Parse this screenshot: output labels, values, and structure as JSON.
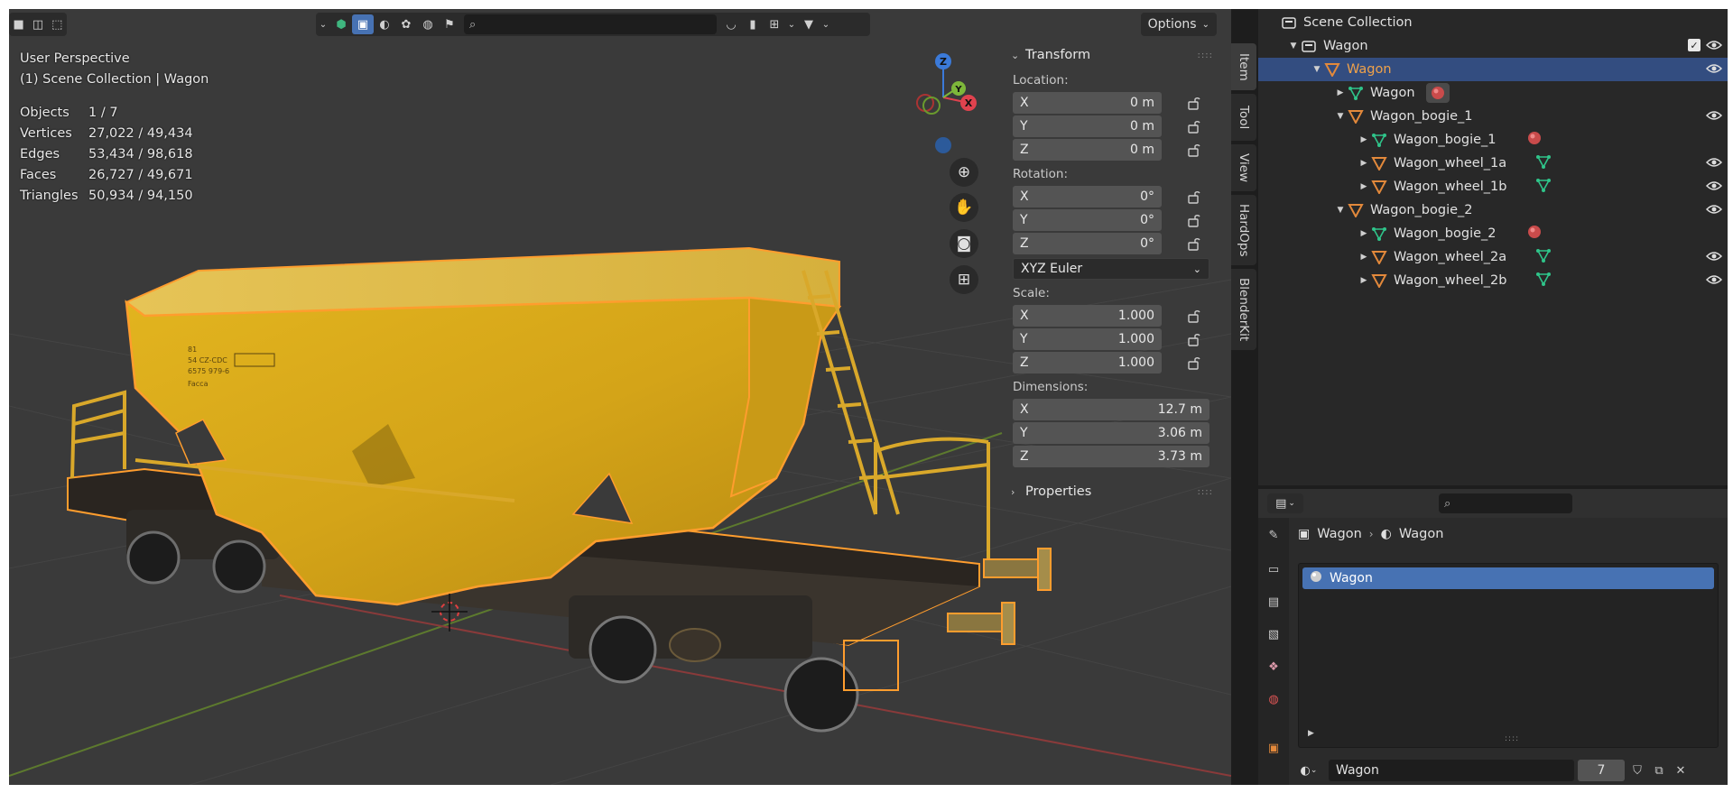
{
  "viewport": {
    "header": {
      "options_label": "Options",
      "search_placeholder": ""
    },
    "info": {
      "perspective": "User Perspective",
      "collection": "(1) Scene Collection | Wagon"
    },
    "stats": [
      {
        "label": "Objects",
        "value": "1 / 7"
      },
      {
        "label": "Vertices",
        "value": "27,022 / 49,434"
      },
      {
        "label": "Edges",
        "value": "53,434 / 98,618"
      },
      {
        "label": "Faces",
        "value": "26,727 / 49,671"
      },
      {
        "label": "Triangles",
        "value": "50,934 / 94,150"
      }
    ],
    "gizmo": {
      "z": "Z",
      "y": "Y",
      "x": "X"
    },
    "wagon_markings": [
      "81",
      "54 CZ-CDC",
      "6575 979-6",
      "Facca"
    ]
  },
  "npanel": {
    "transform": {
      "header": "Transform",
      "location_label": "Location:",
      "location": [
        {
          "axis": "X",
          "value": "0 m"
        },
        {
          "axis": "Y",
          "value": "0 m"
        },
        {
          "axis": "Z",
          "value": "0 m"
        }
      ],
      "rotation_label": "Rotation:",
      "rotation": [
        {
          "axis": "X",
          "value": "0°"
        },
        {
          "axis": "Y",
          "value": "0°"
        },
        {
          "axis": "Z",
          "value": "0°"
        }
      ],
      "rotation_mode": "XYZ Euler",
      "scale_label": "Scale:",
      "scale": [
        {
          "axis": "X",
          "value": "1.000"
        },
        {
          "axis": "Y",
          "value": "1.000"
        },
        {
          "axis": "Z",
          "value": "1.000"
        }
      ],
      "dimensions_label": "Dimensions:",
      "dimensions": [
        {
          "axis": "X",
          "value": "12.7 m"
        },
        {
          "axis": "Y",
          "value": "3.06 m"
        },
        {
          "axis": "Z",
          "value": "3.73 m"
        }
      ]
    },
    "properties_header": "Properties",
    "side_tabs": [
      "Item",
      "Tool",
      "View",
      "HardOps",
      "BlenderKit"
    ]
  },
  "outliner": {
    "rows": [
      {
        "label": "Scene Collection",
        "type": "scene"
      },
      {
        "label": "Wagon",
        "type": "collection"
      },
      {
        "label": "Wagon",
        "type": "object"
      },
      {
        "label": "Wagon",
        "type": "mesh"
      },
      {
        "label": "Wagon_bogie_1",
        "type": "object"
      },
      {
        "label": "Wagon_bogie_1",
        "type": "mesh"
      },
      {
        "label": "Wagon_wheel_1a",
        "type": "object"
      },
      {
        "label": "Wagon_wheel_1b",
        "type": "object"
      },
      {
        "label": "Wagon_bogie_2",
        "type": "object"
      },
      {
        "label": "Wagon_bogie_2",
        "type": "mesh"
      },
      {
        "label": "Wagon_wheel_2a",
        "type": "object"
      },
      {
        "label": "Wagon_wheel_2b",
        "type": "object"
      }
    ]
  },
  "properties": {
    "breadcrumb": [
      "Wagon",
      "Wagon"
    ],
    "material_slot": "Wagon",
    "material_name": "Wagon",
    "user_count": "7"
  },
  "colors": {
    "accent": "#4772b3",
    "selection_outline": "#f59a2a",
    "object_orange": "#e3893b",
    "mesh_green": "#2fc48a",
    "material_red": "#c94b4b"
  }
}
